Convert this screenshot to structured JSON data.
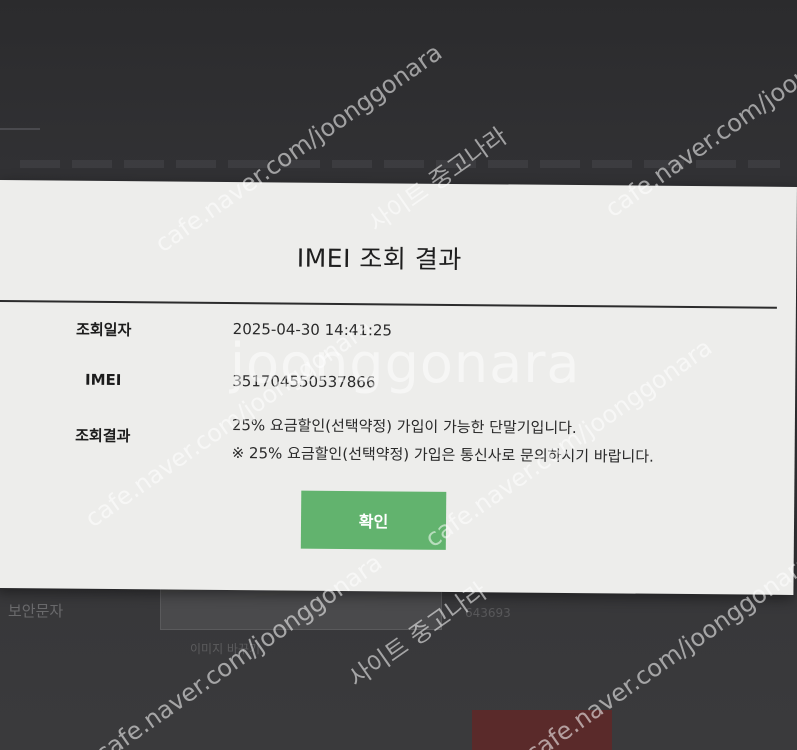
{
  "background": {
    "captcha_label": "보안문자",
    "captcha_hint": "643693",
    "captcha_refresh": "이미지 바꾸기"
  },
  "modal": {
    "title": "IMEI 조회 결과",
    "rows": {
      "date_label": "조회일자",
      "date_value": "2025-04-30 14:41:25",
      "imei_label": "IMEI",
      "imei_value": "351704550537866",
      "result_label": "조회결과",
      "result_line1": "25% 요금할인(선택약정) 가입이 가능한 단말기입니다.",
      "result_line2": "※ 25% 요금할인(선택약정) 가입은 통신사로 문의하시기 바랍니다."
    },
    "confirm_label": "확인"
  },
  "watermarks": {
    "site": "cafe.naver.com/joonggonara",
    "korean": "사이트 중고나라",
    "center": "joonggonara"
  },
  "colors": {
    "confirm_button": "#62b36e",
    "modal_background": "#ededeb"
  }
}
